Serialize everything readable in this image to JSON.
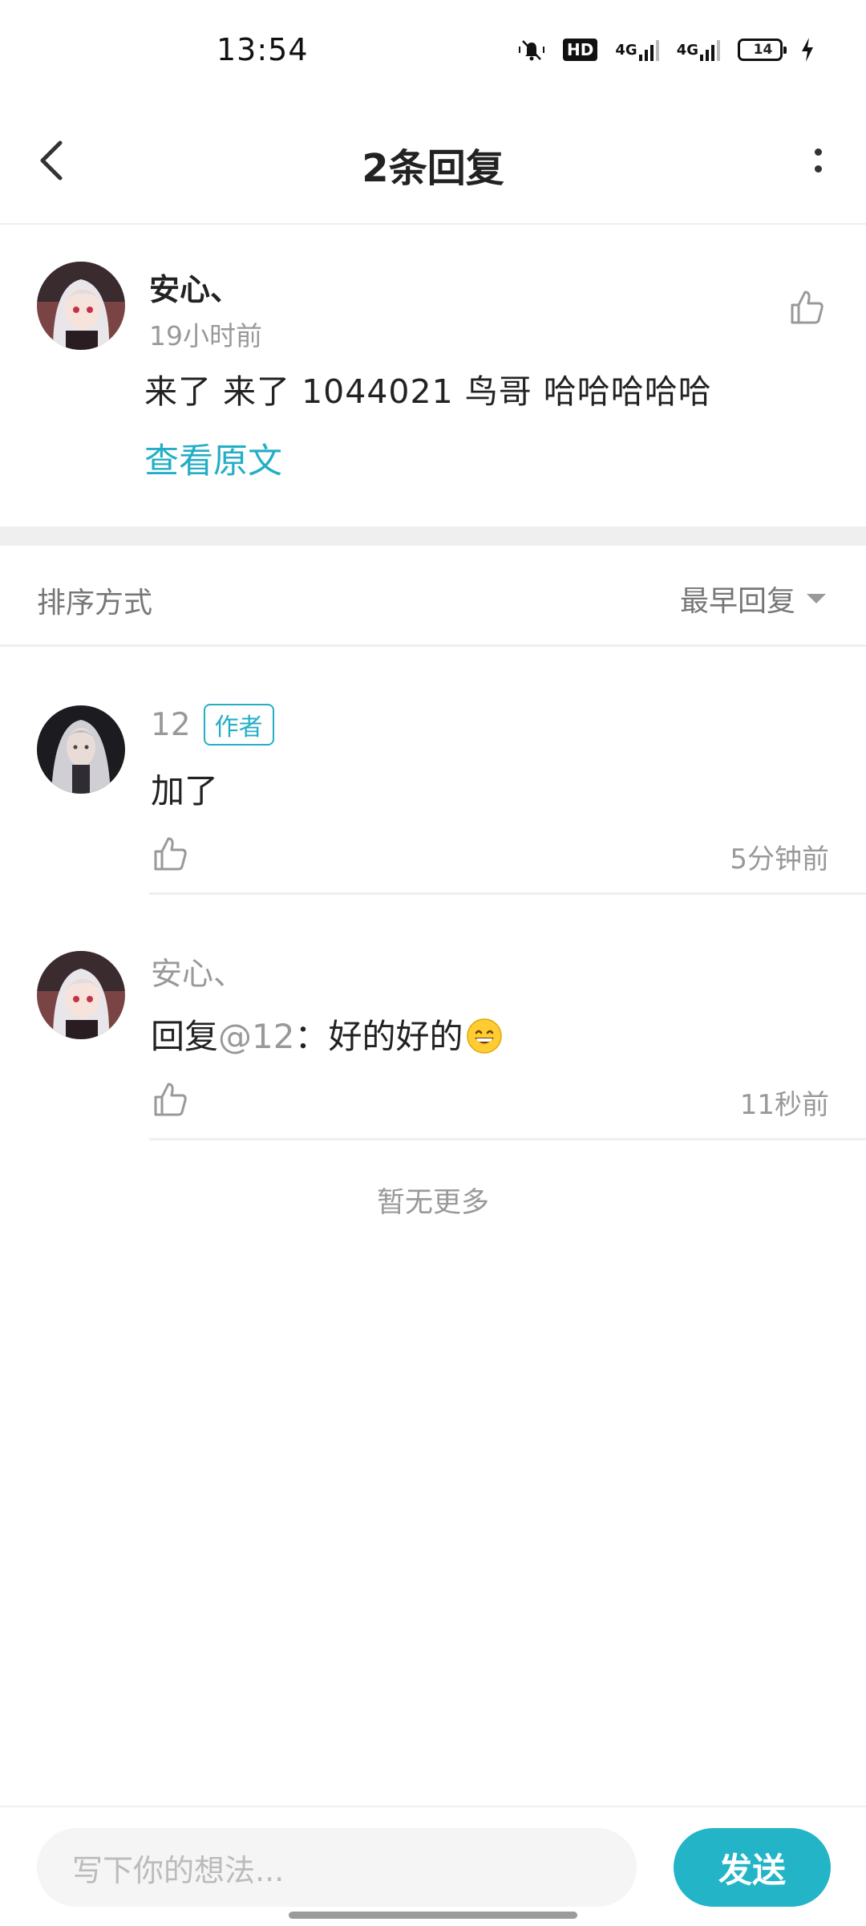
{
  "status_bar": {
    "time": "13:54",
    "hd_label": "HD",
    "network_1": "4G",
    "network_2": "4G",
    "battery": "14"
  },
  "header": {
    "title": "2条回复"
  },
  "main_comment": {
    "author": "安心、",
    "time": "19小时前",
    "text": "来了 来了 1044021 鸟哥 哈哈哈哈哈",
    "view_original": "查看原文"
  },
  "sort": {
    "label": "排序方式",
    "selected": "最早回复"
  },
  "replies": [
    {
      "author": "12",
      "badge": "作者",
      "text": "加了",
      "time": "5分钟前"
    },
    {
      "author": "安心、",
      "reply_prefix": "回复",
      "mention": "@12",
      "text": "：好的好的",
      "time": "11秒前"
    }
  ],
  "footer": {
    "no_more": "暂无更多",
    "input_placeholder": "写下你的想法...",
    "send_label": "发送"
  },
  "colors": {
    "accent": "#23aec5",
    "send_button": "#23b4c7",
    "muted_text": "#999999",
    "divider": "#efefef"
  }
}
